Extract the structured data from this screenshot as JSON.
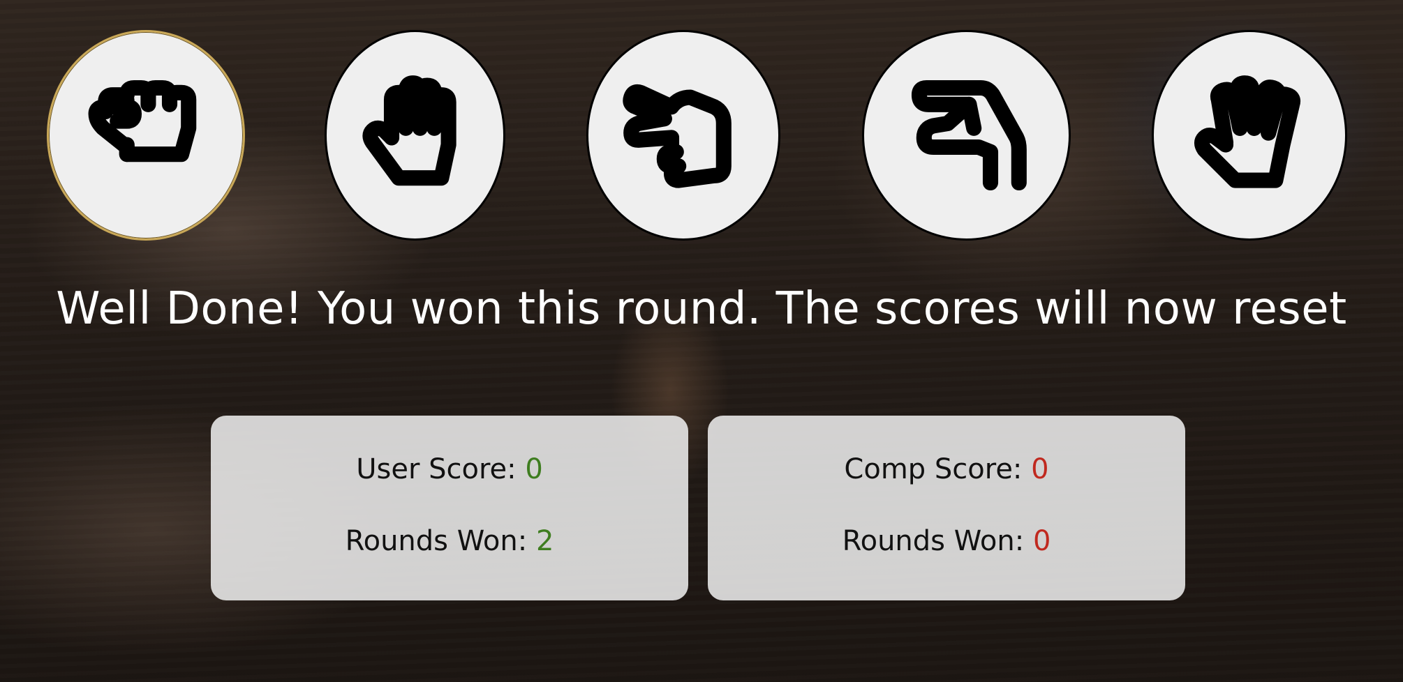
{
  "choices": [
    {
      "name": "rock",
      "icon": "rock-hand-icon",
      "selected": true
    },
    {
      "name": "paper",
      "icon": "paper-hand-icon",
      "selected": false
    },
    {
      "name": "scissors",
      "icon": "scissors-hand-icon",
      "selected": false
    },
    {
      "name": "lizard",
      "icon": "lizard-hand-icon",
      "selected": false
    },
    {
      "name": "spock",
      "icon": "spock-hand-icon",
      "selected": false
    }
  ],
  "message": "Well Done! You won this round. The scores will now reset",
  "user": {
    "score_label": "User Score: ",
    "score_value": "0",
    "rounds_label": "Rounds Won: ",
    "rounds_value": "2"
  },
  "comp": {
    "score_label": "Comp Score: ",
    "score_value": "0",
    "rounds_label": "Rounds Won: ",
    "rounds_value": "0"
  },
  "colors": {
    "user_value": "#3e7d1f",
    "comp_value": "#c0291f",
    "selected_ring": "#c9a858"
  }
}
